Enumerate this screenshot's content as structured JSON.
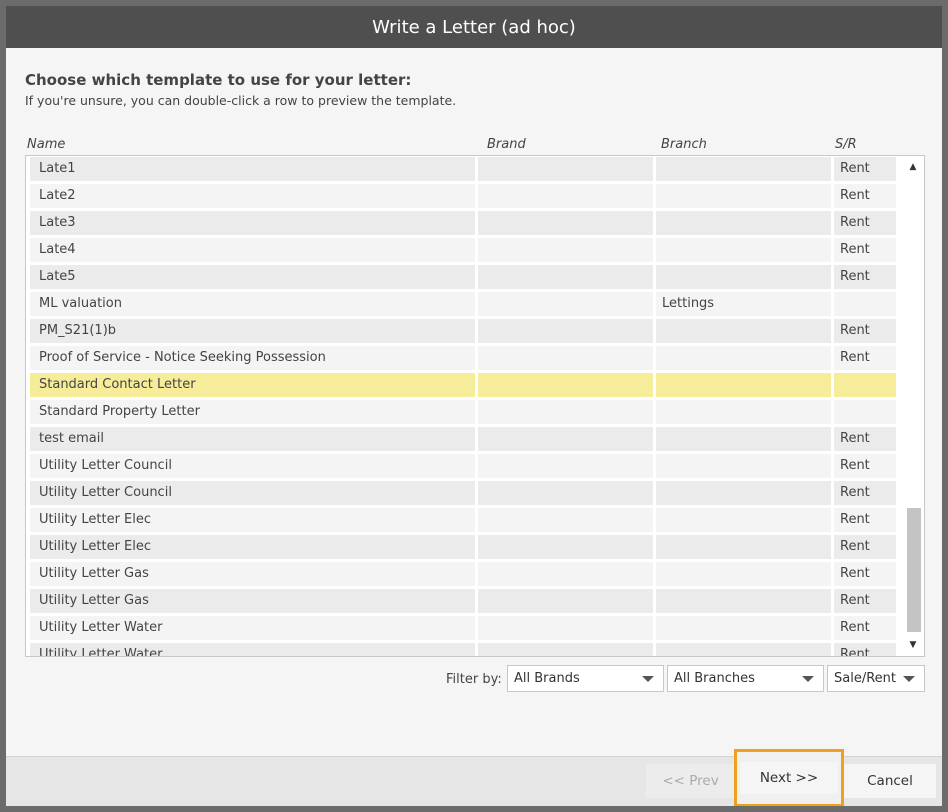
{
  "window": {
    "title": "Write a Letter (ad hoc)"
  },
  "intro": {
    "heading": "Choose which template to use for your letter:",
    "subheading": "If you're unsure, you can double-click a row to preview the template."
  },
  "table": {
    "columns": [
      "Name",
      "Brand",
      "Branch",
      "S/R"
    ],
    "selected_index": 8,
    "rows": [
      {
        "name": "Late1",
        "brand": "",
        "branch": "",
        "sr": "Rent"
      },
      {
        "name": "Late2",
        "brand": "",
        "branch": "",
        "sr": "Rent"
      },
      {
        "name": "Late3",
        "brand": "",
        "branch": "",
        "sr": "Rent"
      },
      {
        "name": "Late4",
        "brand": "",
        "branch": "",
        "sr": "Rent"
      },
      {
        "name": "Late5",
        "brand": "",
        "branch": "",
        "sr": "Rent"
      },
      {
        "name": "ML valuation",
        "brand": "",
        "branch": "Lettings",
        "sr": ""
      },
      {
        "name": "PM_S21(1)b",
        "brand": "",
        "branch": "",
        "sr": "Rent"
      },
      {
        "name": "Proof of Service - Notice Seeking Possession",
        "brand": "",
        "branch": "",
        "sr": "Rent"
      },
      {
        "name": "Standard Contact Letter",
        "brand": "",
        "branch": "",
        "sr": ""
      },
      {
        "name": "Standard Property Letter",
        "brand": "",
        "branch": "",
        "sr": ""
      },
      {
        "name": "test email",
        "brand": "",
        "branch": "",
        "sr": "Rent"
      },
      {
        "name": "Utility Letter Council",
        "brand": "",
        "branch": "",
        "sr": "Rent"
      },
      {
        "name": "Utility Letter Council",
        "brand": "",
        "branch": "",
        "sr": "Rent"
      },
      {
        "name": "Utility Letter Elec",
        "brand": "",
        "branch": "",
        "sr": "Rent"
      },
      {
        "name": "Utility Letter Elec",
        "brand": "",
        "branch": "",
        "sr": "Rent"
      },
      {
        "name": "Utility Letter Gas",
        "brand": "",
        "branch": "",
        "sr": "Rent"
      },
      {
        "name": "Utility Letter Gas",
        "brand": "",
        "branch": "",
        "sr": "Rent"
      },
      {
        "name": "Utility Letter Water",
        "brand": "",
        "branch": "",
        "sr": "Rent"
      },
      {
        "name": "Utility Letter Water",
        "brand": "",
        "branch": "",
        "sr": "Rent"
      }
    ]
  },
  "filters": {
    "label": "Filter by:",
    "brand": "All Brands",
    "branch": "All Branches",
    "sale_rent": "Sale/Rent"
  },
  "buttons": {
    "prev": "<< Prev",
    "next": "Next >>",
    "cancel": "Cancel"
  },
  "colors": {
    "selected_row": "#f6ec99",
    "focus_outline": "#f0a020",
    "titlebar": "#4f4f4f"
  },
  "icons": {
    "scroll_up": "triangle-up-icon",
    "scroll_down": "triangle-down-icon",
    "dropdown": "chevron-down-icon"
  }
}
